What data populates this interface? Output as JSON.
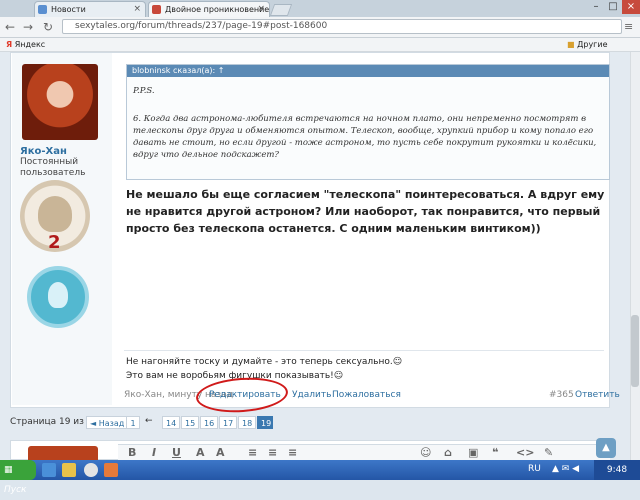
{
  "browser": {
    "tabs": [
      {
        "title": "Новости",
        "active": false
      },
      {
        "title": "Двойное проникновение |",
        "active": true
      }
    ],
    "url": "sexytales.org/forum/threads/237/page-19#post-168600",
    "bookmarks": {
      "left": "Яндекс",
      "right": "Другие закладки"
    }
  },
  "post": {
    "author": "Яко-Хан",
    "author_title": "Постоянный пользователь",
    "badge_number": "2",
    "quote": {
      "header": "blobninsk сказал(а): ↑",
      "pps": "P.P.S.",
      "text": "6. Когда два астронома-любителя встречаются на ночном плато, они непременно посмотрят в телескопы друг друга и обменяются опытом. Телескоп, вообще, хрупкий прибор и кому попало его давать не стоит, но если другой - тоже астроном, то пусть себе покрутит рукоятки и колёсики, вдруг что дельное подскажет?"
    },
    "message": "Не мешало бы еще согласием \"телескопа\" поинтересоваться. А вдруг ему не нравится другой астроном? Или наоборот, так понравится, что первый просто без телескопа останется. С одним маленьким винтиком))",
    "signature": [
      "Не нагоняйте тоску и думайте - это теперь сексуально.☺",
      "Это вам не воробьям фигушки показывать!☺"
    ],
    "meta": "Яко-Хан, минуту назад",
    "actions": {
      "edit": "Редактировать",
      "delete": "Удалить",
      "report": "Пожаловаться",
      "reply": "Ответить"
    },
    "number": "#365"
  },
  "pagination": {
    "info": "Страница 19 из 19",
    "prev": "◄ Назад",
    "pages": [
      "1",
      "←",
      "14",
      "15",
      "16",
      "17",
      "18",
      "19"
    ],
    "current": "19"
  },
  "editor_tools": [
    "B",
    "I",
    "U",
    "A",
    "A",
    "≡",
    "≡",
    "≡",
    "☺",
    "⌂",
    "▣",
    "❝",
    "<>",
    "✎"
  ],
  "taskbar": {
    "start": "Пуск",
    "lang": "RU",
    "time": "9:48"
  },
  "colors": {
    "link": "#2e6fa0",
    "quote_header": "#5b8ab5",
    "annotation": "#d01a1a"
  }
}
